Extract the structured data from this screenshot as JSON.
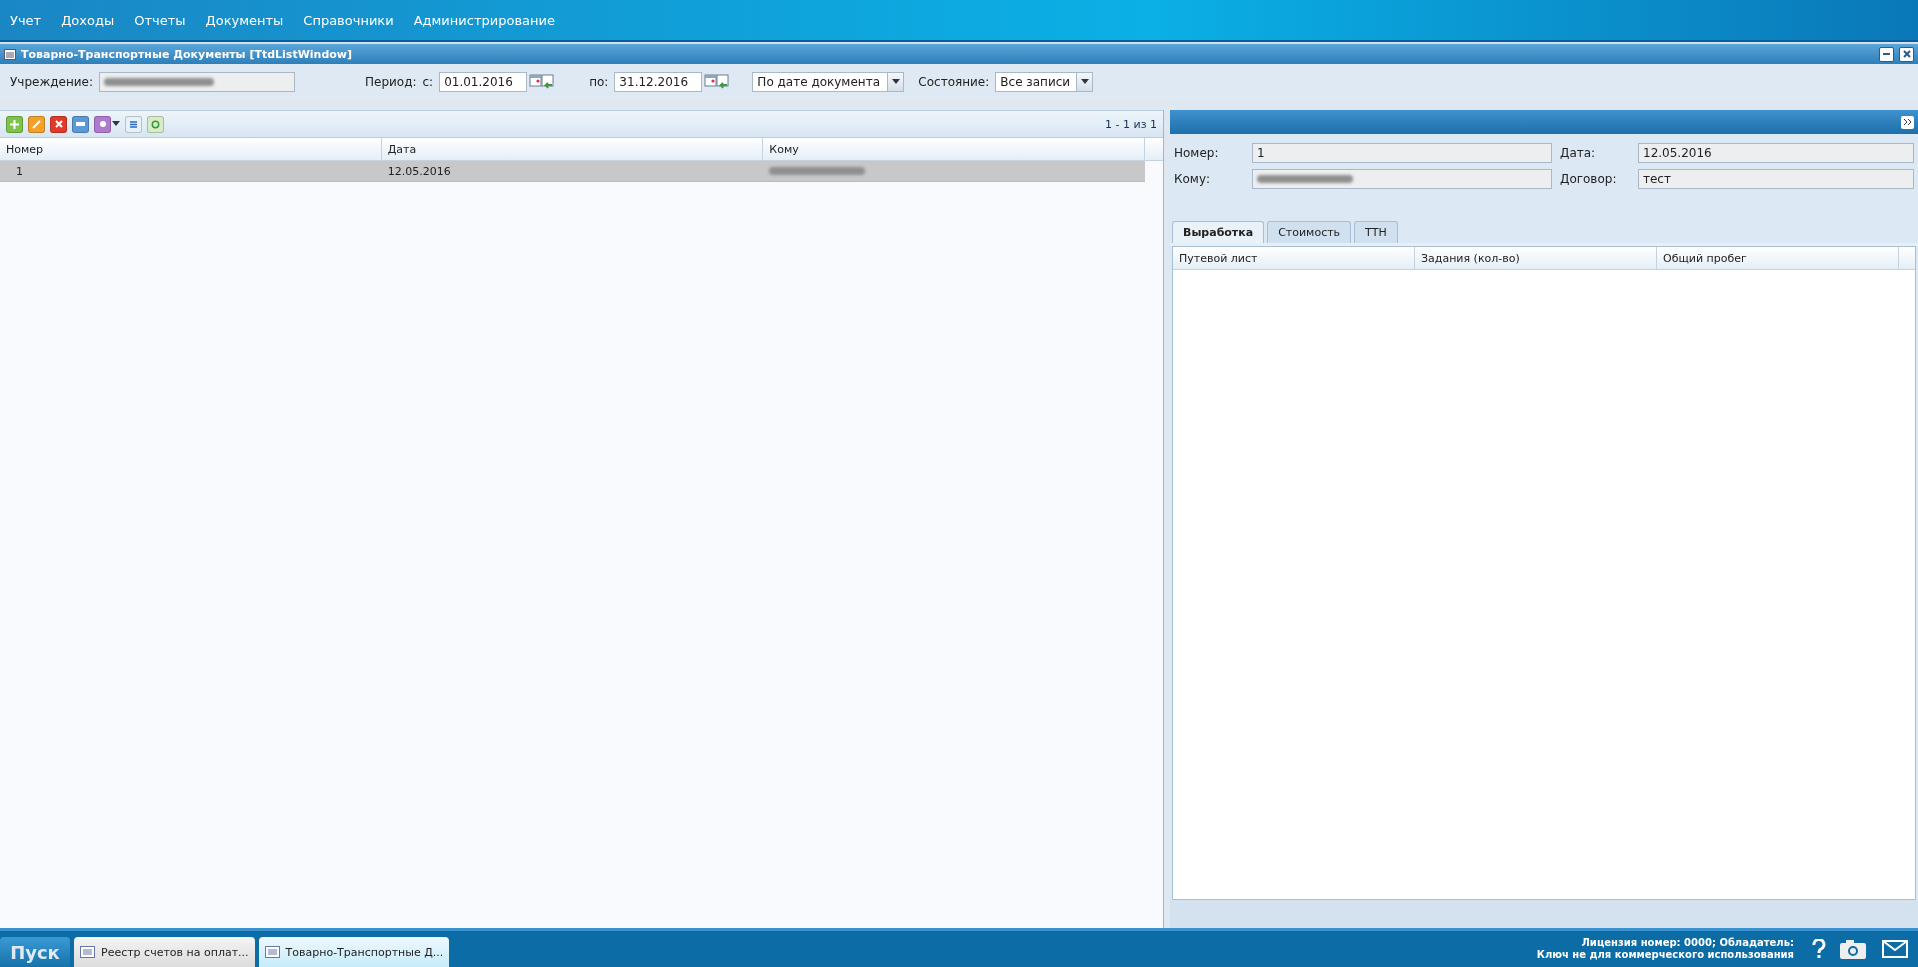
{
  "menu": [
    {
      "label": "Учет"
    },
    {
      "label": "Доходы"
    },
    {
      "label": "Отчеты"
    },
    {
      "label": "Документы"
    },
    {
      "label": "Справочники"
    },
    {
      "label": "Администрирование"
    }
  ],
  "window": {
    "title": "Товарно-Транспортные Документы [TtdListWindow]"
  },
  "filters": {
    "institution_label": "Учреждение:",
    "period_label": "Период:",
    "from_label": "с:",
    "from_value": "01.01.2016",
    "to_label": "по:",
    "to_value": "31.12.2016",
    "date_mode": "По дате документа",
    "state_label": "Состояние:",
    "state_value": "Все записи"
  },
  "list": {
    "pager": "1 - 1 из 1",
    "columns": [
      "Номер",
      "Дата",
      "Кому"
    ],
    "rows": [
      {
        "cells": [
          "1",
          "12.05.2016"
        ],
        "selected": true
      }
    ]
  },
  "detail": {
    "fields": [
      {
        "label": "Номер:",
        "value": "1"
      },
      {
        "label": "Дата:",
        "value": "12.05.2016"
      },
      {
        "label": "Кому:"
      },
      {
        "label": "Договор:",
        "value": "тест"
      }
    ],
    "tabs": [
      {
        "label": "Выработка",
        "selected": true
      },
      {
        "label": "Стоимость",
        "selected": false
      },
      {
        "label": "ТТН",
        "selected": false
      }
    ],
    "columns": [
      "Путевой лист",
      "Задания (кол-во)",
      "Общий пробег"
    ]
  },
  "taskbar": {
    "start": "Пуск",
    "tasks": [
      {
        "label": "Реестр счетов на оплат...",
        "selected": false
      },
      {
        "label": "Товарно-Транспортные Д...",
        "selected": true
      }
    ],
    "license": [
      "Лицензия номер: 0000; Обладатель:",
      "Ключ не для коммерческого использования"
    ]
  }
}
